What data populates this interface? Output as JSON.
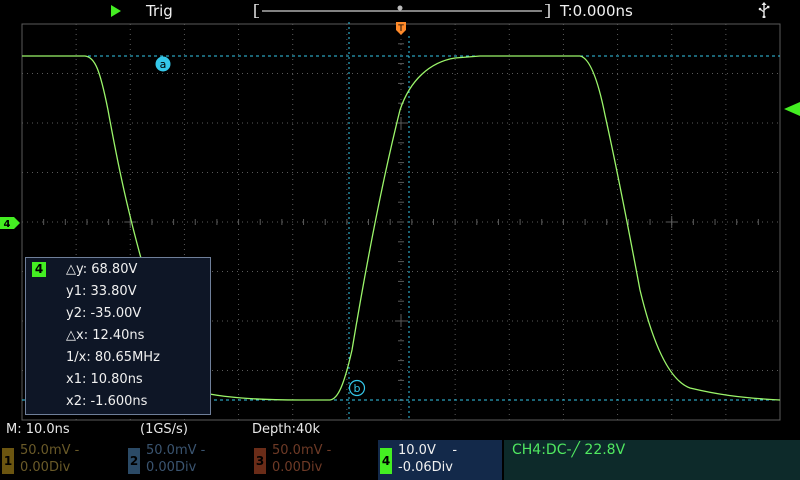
{
  "top": {
    "run_state_icon": "play-triangle-icon",
    "trigger_label": "Trig",
    "timebase_position": "T:0.000ns",
    "usb_icon": "usb-icon"
  },
  "screen": {
    "grid_color": "#5a5a5a",
    "trace_color": "#9bf56a",
    "cursor_color": "#35c8ea",
    "trigger_marker_color": "#ff8a2a",
    "ch4_marker_label": "4",
    "cursor_y1_tag": "a",
    "cursor_y2_tag": "b"
  },
  "cursors": {
    "channel": "4",
    "dy": "△y: 68.80V",
    "y1": "y1: 33.80V",
    "y2": "y2: -35.00V",
    "dx": "△x: 12.40ns",
    "inv_x": "1/x: 80.65MHz",
    "x1": "x1: 10.80ns",
    "x2": "x2: -1.600ns"
  },
  "status": {
    "timebase": "M: 10.0ns",
    "sample_rate": "(1GS/s)",
    "depth": "Depth:40k"
  },
  "channels": [
    {
      "num": "1",
      "scale": "50.0mV -",
      "offset": "0.00Div",
      "active": false,
      "color": "#6b5510"
    },
    {
      "num": "2",
      "scale": "50.0mV -",
      "offset": "0.00Div",
      "active": false,
      "color": "#2b4a66"
    },
    {
      "num": "3",
      "scale": "50.0mV -",
      "offset": "0.00Div",
      "active": false,
      "color": "#6a2c18"
    },
    {
      "num": "4",
      "scale": "10.0V    -",
      "offset": "-0.06Div",
      "active": true,
      "color": "#44ee22"
    }
  ],
  "trigger_info": "CH4:DC-╱ 22.8V"
}
